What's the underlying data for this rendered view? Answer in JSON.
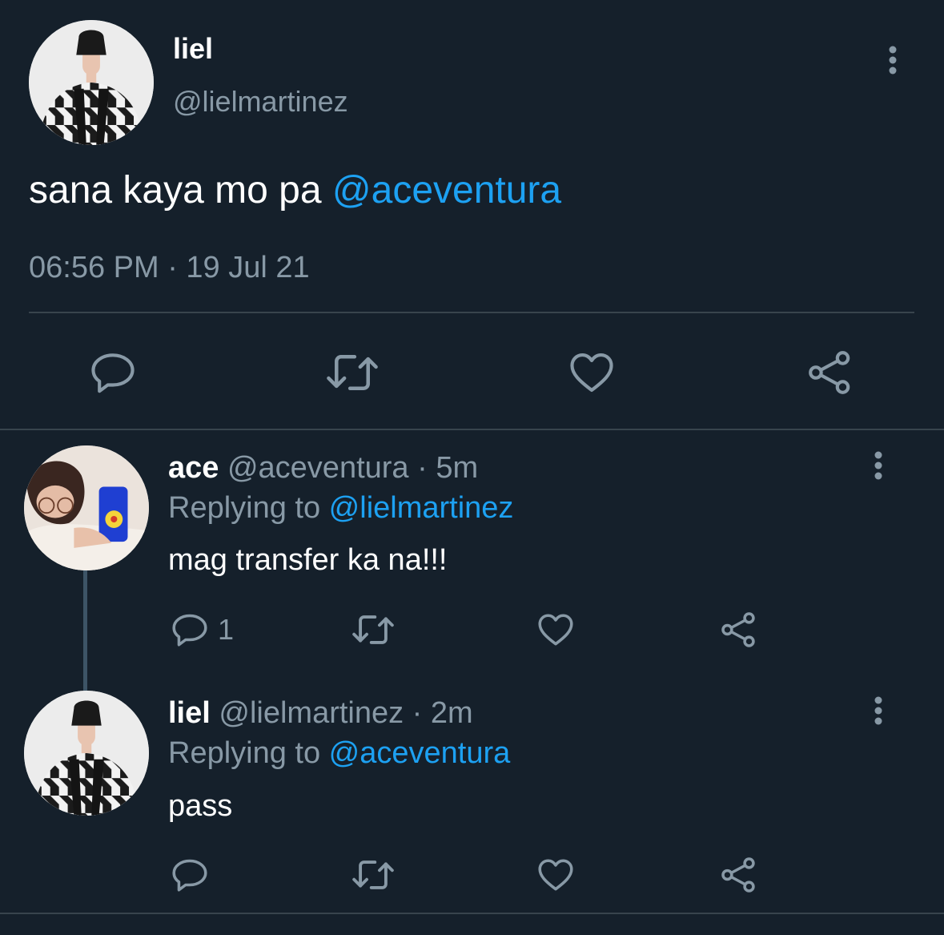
{
  "main_tweet": {
    "display_name": "liel",
    "handle": "@lielmartinez",
    "text": "sana kaya mo pa ",
    "mention": "@aceventura",
    "timestamp": "06:56 PM · 19 Jul 21"
  },
  "replies": [
    {
      "display_name": "ace",
      "handle": "@aceventura",
      "time": " · 5m",
      "replying_label": "Replying to ",
      "replying_to": "@lielmartinez",
      "text": "mag transfer ka na!!!",
      "reply_count": "1"
    },
    {
      "display_name": "liel",
      "handle": "@lielmartinez",
      "time": " · 2m",
      "replying_label": "Replying to ",
      "replying_to": "@aceventura",
      "text": "pass",
      "reply_count": ""
    }
  ],
  "icons": {
    "reply": "reply-icon",
    "retweet": "retweet-icon",
    "like": "heart-icon",
    "share": "share-icon",
    "more": "more-vertical-icon"
  },
  "colors": {
    "background": "#15202b",
    "text": "#ffffff",
    "secondary": "#8899a6",
    "accent": "#1da1f2",
    "divider": "#38444d"
  }
}
